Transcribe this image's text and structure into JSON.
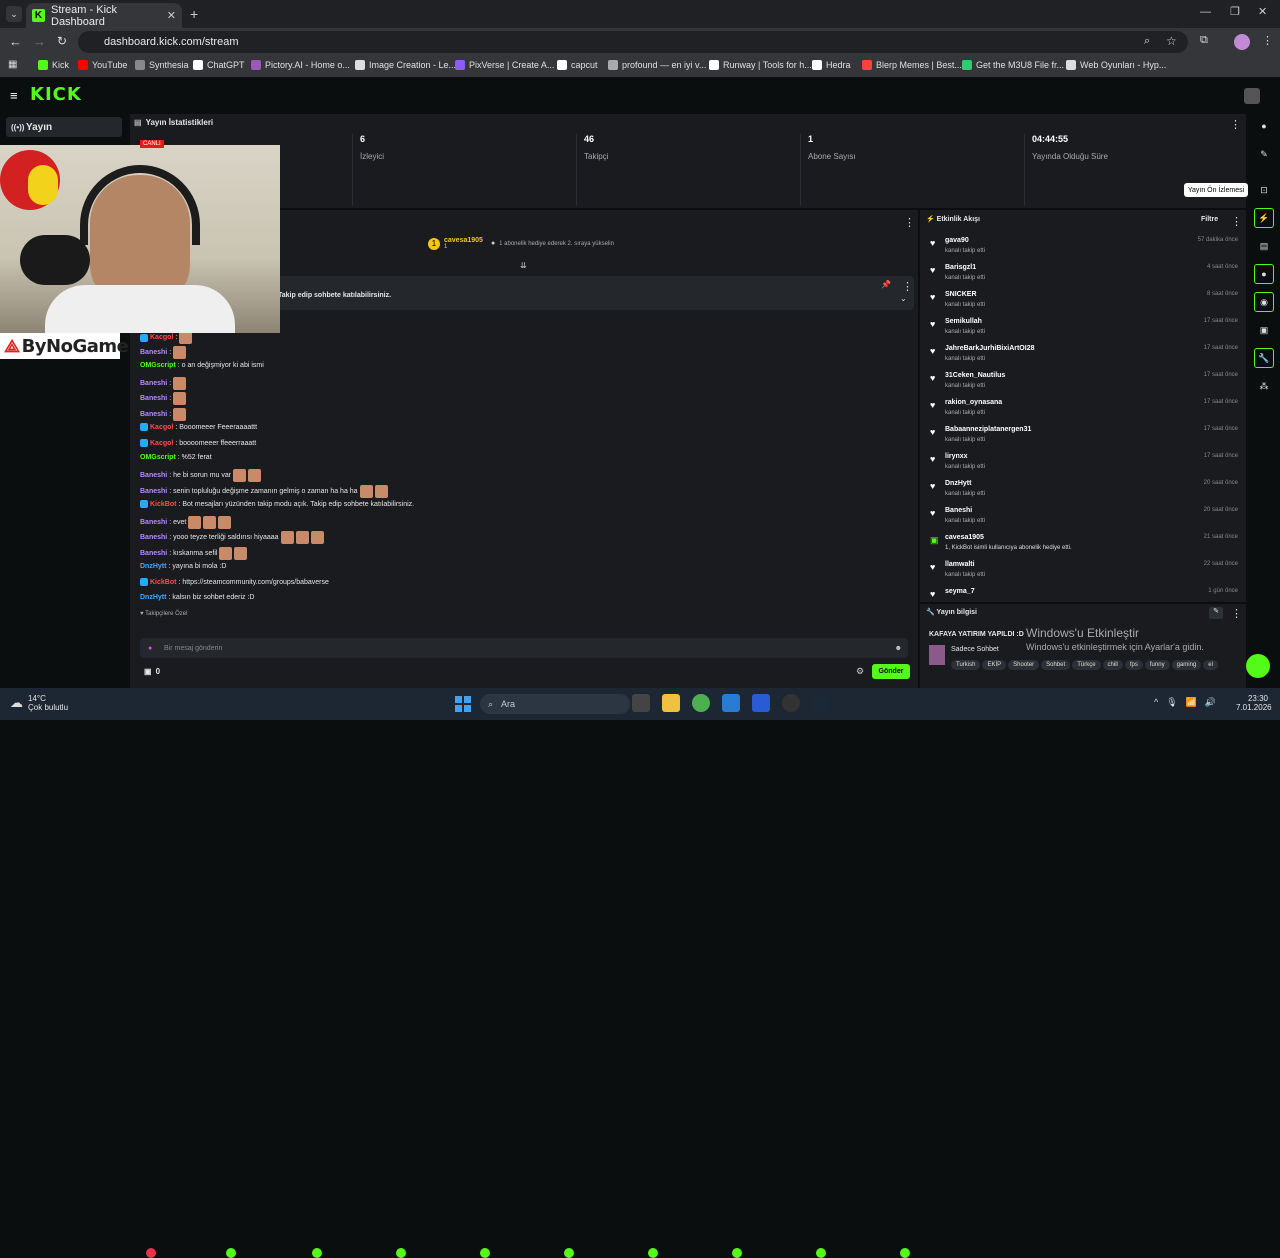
{
  "browser": {
    "tab_title": "Stream - Kick Dashboard",
    "url": "dashboard.kick.com/stream",
    "bookmarks": [
      "Kick",
      "YouTube",
      "Synthesia",
      "ChatGPT",
      "Pictory.AI - Home o...",
      "Image Creation - Le...",
      "PixVerse | Create A...",
      "capcut",
      "profound — en iyi v...",
      "Runway | Tools for h...",
      "Hedra",
      "Blerp Memes | Best...",
      "Get the M3U8 File fr...",
      "Web Oyunları - Hyp..."
    ]
  },
  "kick": {
    "logo": "KICK",
    "nav_selected": "Yayın",
    "nav_partial": "Sohbet"
  },
  "stats": {
    "title": "Yayın İstatistikleri",
    "items": [
      {
        "value": "6",
        "label": "İzleyici"
      },
      {
        "value": "46",
        "label": "Takipçi"
      },
      {
        "value": "1",
        "label": "Abone Sayısı"
      },
      {
        "value": "04:44:55",
        "label": "Yayında Olduğu Süre"
      }
    ],
    "live_badge": "CANLI"
  },
  "tooltip": "Yayın Ön İzlemesi",
  "chat": {
    "top_user": "cavesa1905",
    "top_count": "1",
    "top_hint": "1 abonelik hediye ederek 2. sıraya yükselin",
    "pinned": "Takip edip sohbete katılabilirsiniz.",
    "messages": [
      {
        "user": "Kacgol",
        "cls": "un-r",
        "text": ":",
        "emotes": 1,
        "badge": true
      },
      {
        "user": "Baneshi",
        "cls": "un-p",
        "text": ":",
        "emotes": 1
      },
      {
        "user": "OMGscript",
        "cls": "un-g",
        "text": ": o an değişmiyor ki abi ismi",
        "emotes": 0
      },
      {
        "user": "Baneshi",
        "cls": "un-p",
        "text": ":",
        "emotes": 1
      },
      {
        "user": "Baneshi",
        "cls": "un-p",
        "text": ":",
        "emotes": 1
      },
      {
        "user": "Baneshi",
        "cls": "un-p",
        "text": ":",
        "emotes": 1
      },
      {
        "user": "Kacgol",
        "cls": "un-r",
        "text": ": Booomeeer Feeeraaaattt",
        "emotes": 0,
        "badge": true
      },
      {
        "user": "Kacgol",
        "cls": "un-r",
        "text": ": boooomeeer ffeeerraaatt",
        "emotes": 0,
        "badge": true
      },
      {
        "user": "OMGscript",
        "cls": "un-g",
        "text": ": %52 ferat",
        "emotes": 0
      },
      {
        "user": "Baneshi",
        "cls": "un-p",
        "text": ": he bi sorun mu var",
        "emotes": 2
      },
      {
        "user": "Baneshi",
        "cls": "un-p",
        "text": ": senin topluluğu değişme zamanın gelmiş o zaman ha ha ha",
        "emotes": 2
      },
      {
        "user": "KickBot",
        "cls": "un-r",
        "text": ": Bot mesajları yüzünden takip modu açık. Takip edip sohbete katılabilirsiniz.",
        "emotes": 0,
        "badge": true
      },
      {
        "user": "Baneshi",
        "cls": "un-p",
        "text": ": evet",
        "emotes": 3
      },
      {
        "user": "Baneshi",
        "cls": "un-p",
        "text": ": yooo teyze terliği saldırısı hiyaaaa",
        "emotes": 3
      },
      {
        "user": "Baneshi",
        "cls": "un-p",
        "text": ": kıskanma sefil",
        "emotes": 2
      },
      {
        "user": "DnzHytt",
        "cls": "un-b",
        "text": ": yayına bi mola :D",
        "emotes": 0
      },
      {
        "user": "KickBot",
        "cls": "un-r",
        "text": ": https://steamcommunity.com/groups/babaverse",
        "emotes": 0,
        "badge": true
      },
      {
        "user": "DnzHytt",
        "cls": "un-b",
        "text": ": kalsın biz sohbet ederiz :D",
        "emotes": 0
      }
    ],
    "followers_only": "Takipçilere Özel",
    "input_placeholder": "Bir mesaj gönderin",
    "points": "0",
    "send": "Gönder"
  },
  "activity": {
    "title": "Etkinlik Akışı",
    "filter": "Filtre",
    "items": [
      {
        "name": "gava90",
        "sub": "kanalı takip etti",
        "time": "57 dakika önce"
      },
      {
        "name": "Barisgzl1",
        "sub": "kanalı takip etti",
        "time": "4 saat önce"
      },
      {
        "name": "SNICKER",
        "sub": "kanalı takip etti",
        "time": "8 saat önce"
      },
      {
        "name": "Semikullah",
        "sub": "kanalı takip etti",
        "time": "17 saat önce"
      },
      {
        "name": "JahreBarkJurhiBixiArtOI28",
        "sub": "kanalı takip etti",
        "time": "17 saat önce"
      },
      {
        "name": "31Ceken_Nautilus",
        "sub": "kanalı takip etti",
        "time": "17 saat önce"
      },
      {
        "name": "rakion_oynasana",
        "sub": "kanalı takip etti",
        "time": "17 saat önce"
      },
      {
        "name": "Babaanneziplatanergen31",
        "sub": "kanalı takip etti",
        "time": "17 saat önce"
      },
      {
        "name": "lirynxx",
        "sub": "kanalı takip etti",
        "time": "17 saat önce"
      },
      {
        "name": "DnzHytt",
        "sub": "kanalı takip etti",
        "time": "20 saat önce"
      },
      {
        "name": "Baneshi",
        "sub": "kanalı takip etti",
        "time": "20 saat önce"
      },
      {
        "name": "cavesa1905",
        "sub": "1, KickBot isimli kullanıcıya abonelik hediye etti.",
        "time": "21 saat önce"
      },
      {
        "name": "llamwalti",
        "sub": "kanalı takip etti",
        "time": "22 saat önce"
      },
      {
        "name": "seyma_7",
        "sub": "",
        "time": "1 gün önce"
      }
    ]
  },
  "info": {
    "title": "Yayın bilgisi",
    "stream_title": "KAFAYA YATIRIM YAPILDI :D",
    "category": "Sadece Sohbet",
    "tags": [
      "Turkish",
      "EKİP",
      "Shooter",
      "Sohbet",
      "Türkçe",
      "chill",
      "fps",
      "funny",
      "gaming",
      "el"
    ]
  },
  "watermark": {
    "line1": "Windows'u Etkinleştir",
    "line2": "Windows'u etkinleştirmek için Ayarlar'a gidin."
  },
  "overlay": {
    "brand": "ByNoGame"
  },
  "taskbar": {
    "weather_temp": "14°C",
    "weather_desc": "Çok bulutlu",
    "search": "Ara",
    "time": "23:30",
    "date": "7.01.2026"
  }
}
